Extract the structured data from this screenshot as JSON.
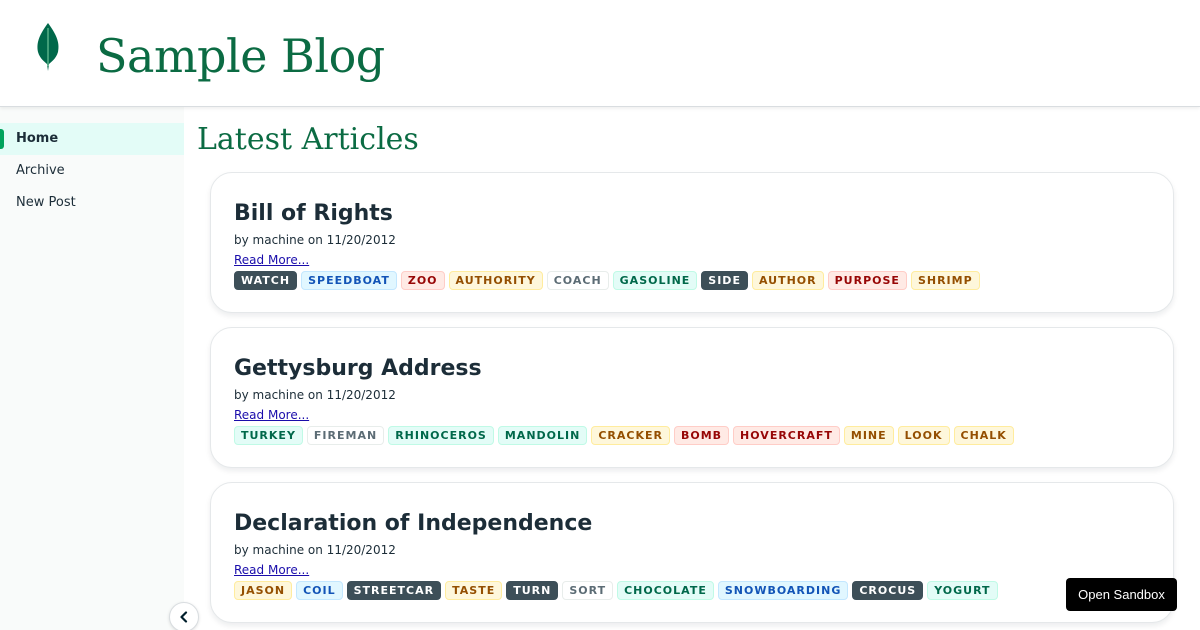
{
  "header": {
    "site_title": "Sample Blog",
    "logo_icon": "leaf-icon"
  },
  "sidebar": {
    "items": [
      {
        "label": "Home",
        "active": true
      },
      {
        "label": "Archive",
        "active": false
      },
      {
        "label": "New Post",
        "active": false
      }
    ],
    "collapse_icon": "chevron-left-icon"
  },
  "main": {
    "heading": "Latest Articles",
    "articles": [
      {
        "title": "Bill of Rights",
        "meta": "by machine on 11/20/2012",
        "read_more": "Read More...",
        "tags": [
          {
            "label": "WATCH",
            "variant": "darkgray"
          },
          {
            "label": "SPEEDBOAT",
            "variant": "blue"
          },
          {
            "label": "ZOO",
            "variant": "red"
          },
          {
            "label": "AUTHORITY",
            "variant": "yellow"
          },
          {
            "label": "COACH",
            "variant": "lightgray"
          },
          {
            "label": "GASOLINE",
            "variant": "green"
          },
          {
            "label": "SIDE",
            "variant": "darkgray"
          },
          {
            "label": "AUTHOR",
            "variant": "yellow"
          },
          {
            "label": "PURPOSE",
            "variant": "red"
          },
          {
            "label": "SHRIMP",
            "variant": "yellow"
          }
        ]
      },
      {
        "title": "Gettysburg Address",
        "meta": "by machine on 11/20/2012",
        "read_more": "Read More...",
        "tags": [
          {
            "label": "TURKEY",
            "variant": "green"
          },
          {
            "label": "FIREMAN",
            "variant": "lightgray"
          },
          {
            "label": "RHINOCEROS",
            "variant": "green"
          },
          {
            "label": "MANDOLIN",
            "variant": "green"
          },
          {
            "label": "CRACKER",
            "variant": "yellow"
          },
          {
            "label": "BOMB",
            "variant": "red"
          },
          {
            "label": "HOVERCRAFT",
            "variant": "red"
          },
          {
            "label": "MINE",
            "variant": "yellow"
          },
          {
            "label": "LOOK",
            "variant": "yellow"
          },
          {
            "label": "CHALK",
            "variant": "yellow"
          }
        ]
      },
      {
        "title": "Declaration of Independence",
        "meta": "by machine on 11/20/2012",
        "read_more": "Read More...",
        "tags": [
          {
            "label": "JASON",
            "variant": "yellow"
          },
          {
            "label": "COIL",
            "variant": "blue"
          },
          {
            "label": "STREETCAR",
            "variant": "darkgray"
          },
          {
            "label": "TASTE",
            "variant": "yellow"
          },
          {
            "label": "TURN",
            "variant": "darkgray"
          },
          {
            "label": "SORT",
            "variant": "lightgray"
          },
          {
            "label": "CHOCOLATE",
            "variant": "green"
          },
          {
            "label": "SNOWBOARDING",
            "variant": "blue"
          },
          {
            "label": "CROCUS",
            "variant": "darkgray"
          },
          {
            "label": "YOGURT",
            "variant": "green"
          }
        ]
      }
    ]
  },
  "sandbox_button": {
    "label": "Open Sandbox"
  },
  "colors": {
    "brand_green": "#0b6b43",
    "accent_green": "#00a35c",
    "link": "#1a0dab"
  }
}
